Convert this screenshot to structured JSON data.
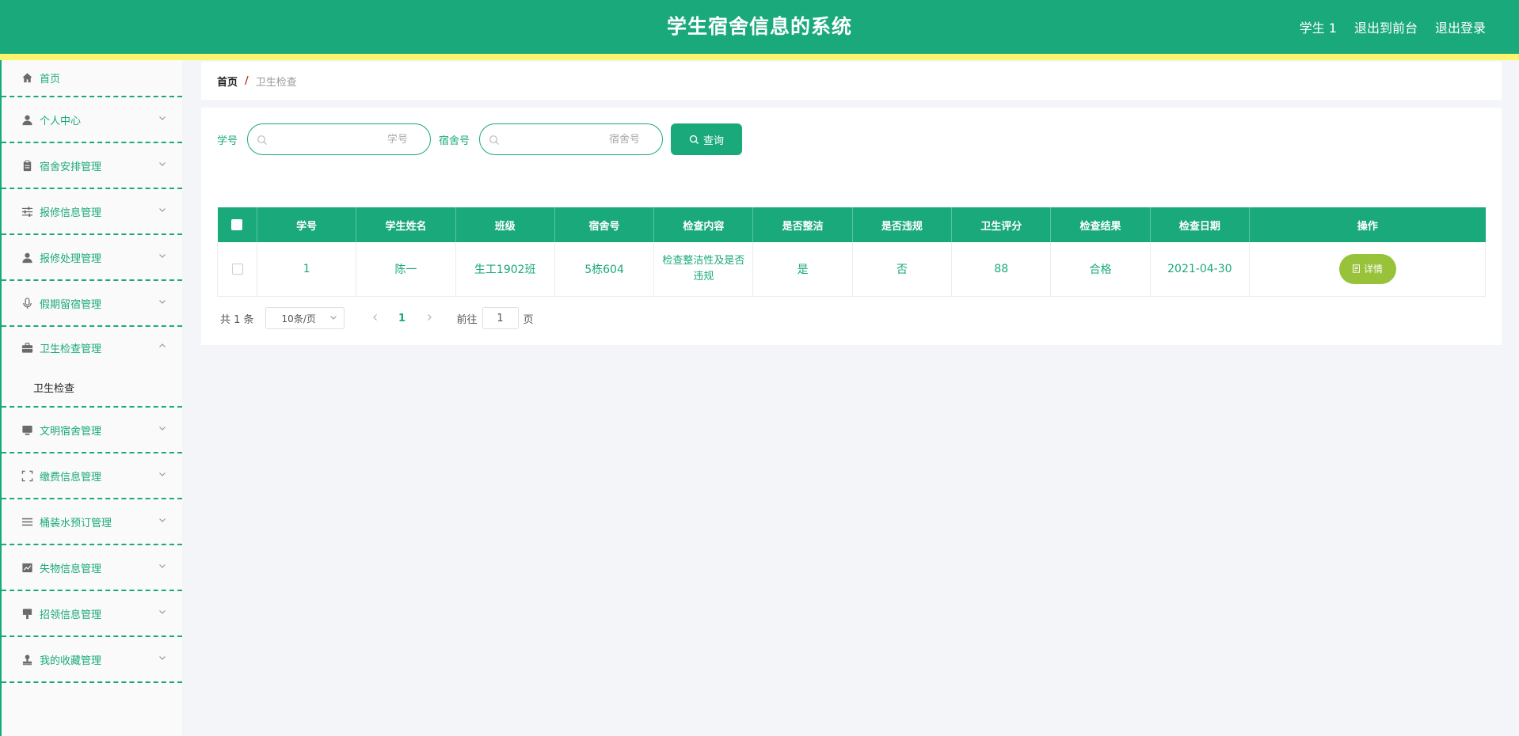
{
  "header": {
    "title": "学生宿舍信息的系统",
    "links": [
      "学生 1",
      "退出到前台",
      "退出登录"
    ]
  },
  "sidebar": {
    "items": [
      {
        "label": "首页",
        "icon": "home-icon"
      },
      {
        "label": "个人中心",
        "icon": "user-icon"
      },
      {
        "label": "宿舍安排管理",
        "icon": "clipboard-icon"
      },
      {
        "label": "报修信息管理",
        "icon": "sliders-icon"
      },
      {
        "label": "报修处理管理",
        "icon": "user-icon"
      },
      {
        "label": "假期留宿管理",
        "icon": "microphone-icon"
      },
      {
        "label": "卫生检查管理",
        "icon": "briefcase-icon",
        "expanded": true,
        "sub": "卫生检查"
      },
      {
        "label": "文明宿舍管理",
        "icon": "monitor-icon"
      },
      {
        "label": "缴费信息管理",
        "icon": "fullscreen-icon"
      },
      {
        "label": "桶装水预订管理",
        "icon": "list-icon"
      },
      {
        "label": "失物信息管理",
        "icon": "chart-icon"
      },
      {
        "label": "招领信息管理",
        "icon": "brush-icon"
      },
      {
        "label": "我的收藏管理",
        "icon": "stamp-icon"
      }
    ]
  },
  "breadcrumb": {
    "home": "首页",
    "separator": "/",
    "current": "卫生检查"
  },
  "search": {
    "field1_label": "学号",
    "field1_placeholder": "学号",
    "field2_label": "宿舍号",
    "field2_placeholder": "宿舍号",
    "button": "查询"
  },
  "table": {
    "columns": [
      "学号",
      "学生姓名",
      "班级",
      "宿舍号",
      "检查内容",
      "是否整洁",
      "是否违规",
      "卫生评分",
      "检查结果",
      "检查日期",
      "操作"
    ],
    "rows": [
      {
        "xuehao": "1",
        "name": "陈一",
        "class": "生工1902班",
        "dorm": "5栋604",
        "content": "检查整洁性及是否违规",
        "clean": "是",
        "violation": "否",
        "score": "88",
        "result": "合格",
        "date": "2021-04-30",
        "action": "详情"
      }
    ]
  },
  "pagination": {
    "total": "共 1 条",
    "page_size": "10条/页",
    "current_page": "1",
    "goto_prefix": "前往",
    "goto_value": "1",
    "goto_suffix": "页"
  },
  "colors": {
    "primary": "#1aa97b",
    "accent_bar": "#fcf56b",
    "detail_button": "#97c23a"
  }
}
